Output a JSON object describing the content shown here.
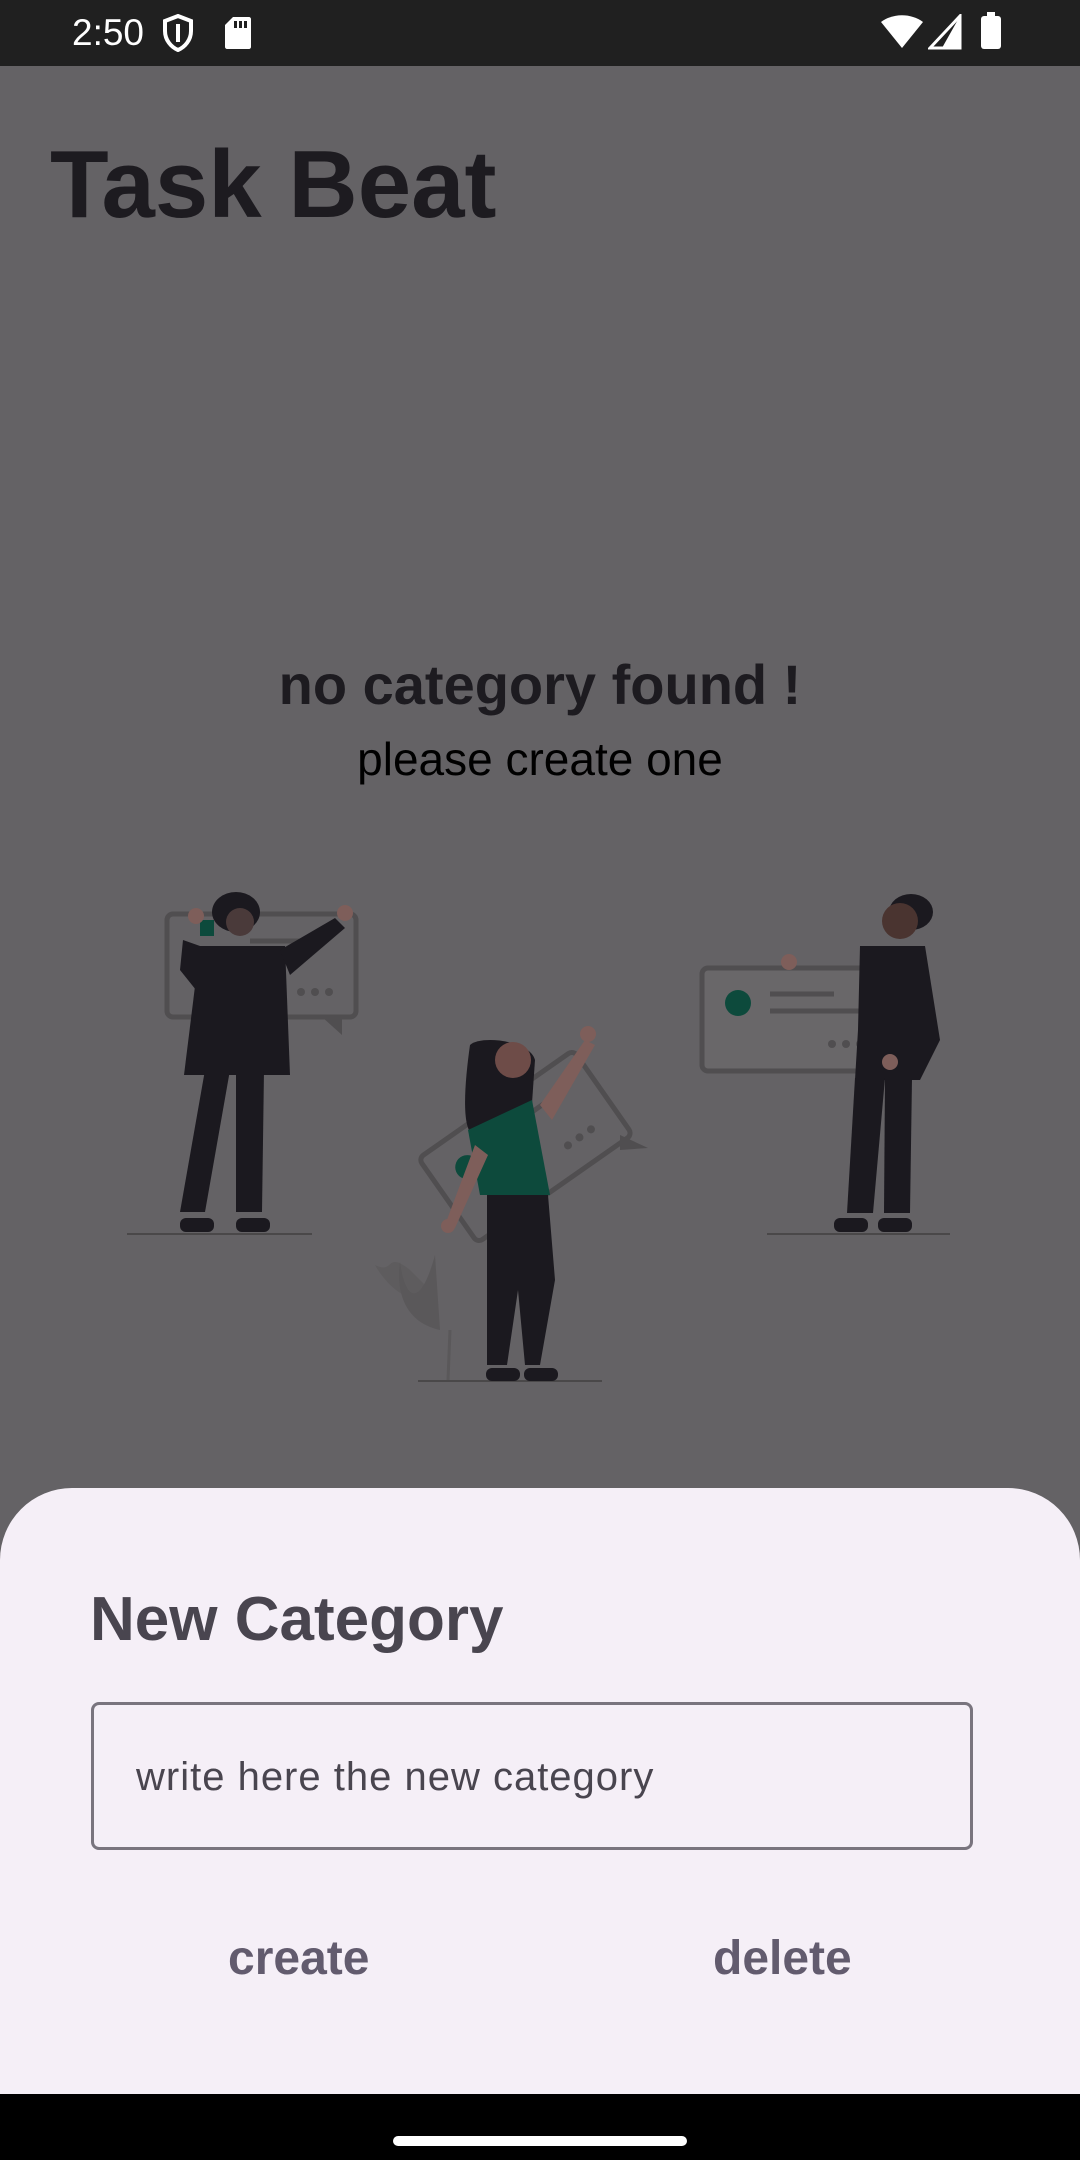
{
  "status_bar": {
    "time": "2:50",
    "left_icons": [
      "shield-icon",
      "sd-card-icon"
    ],
    "right_icons": [
      "wifi-icon",
      "signal-icon",
      "battery-icon"
    ]
  },
  "app": {
    "title": "Task Beat"
  },
  "empty_state": {
    "title": "no category found !",
    "subtitle": "please create one",
    "illustration": "people-holding-message-cards-illustration"
  },
  "dialog": {
    "title": "New Category",
    "input_placeholder": "write here the new category",
    "input_value": "",
    "create_label": "create",
    "delete_label": "delete"
  },
  "colors": {
    "scrim": "#646265",
    "sheet": "#f5eff7",
    "accent_green": "#0d4a3c",
    "text_dark": "#1d1b20"
  }
}
